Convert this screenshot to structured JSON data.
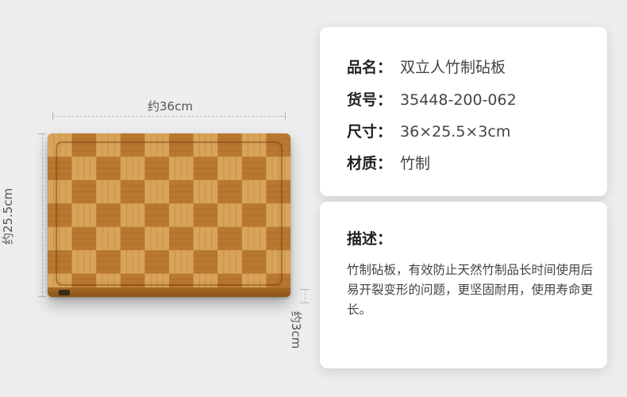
{
  "dimensions": {
    "length_label": "约36cm",
    "width_label": "约25.5cm",
    "thickness_label": "约3cm"
  },
  "specs": [
    {
      "key": "品名：",
      "value": "双立人竹制砧板"
    },
    {
      "key": "货号：",
      "value": "35448-200-062"
    },
    {
      "key": "尺寸：",
      "value": "36×25.5×3cm"
    },
    {
      "key": "材质：",
      "value": "竹制"
    }
  ],
  "description": {
    "title": "描述：",
    "text": "竹制砧板，有效防止天然竹制品长时间使用后易开裂变形的问题，更坚固耐用，使用寿命更长。"
  },
  "colors": {
    "background": "#ededed",
    "card": "#ffffff",
    "bamboo_light": "#d9a45a",
    "bamboo_dark": "#b8782f"
  }
}
